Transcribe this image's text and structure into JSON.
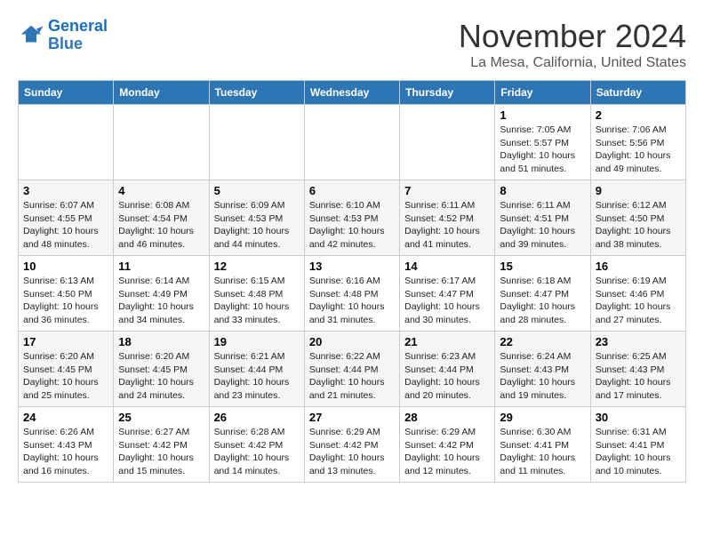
{
  "header": {
    "logo_line1": "General",
    "logo_line2": "Blue",
    "month": "November 2024",
    "location": "La Mesa, California, United States"
  },
  "weekdays": [
    "Sunday",
    "Monday",
    "Tuesday",
    "Wednesday",
    "Thursday",
    "Friday",
    "Saturday"
  ],
  "weeks": [
    [
      {
        "day": "",
        "info": ""
      },
      {
        "day": "",
        "info": ""
      },
      {
        "day": "",
        "info": ""
      },
      {
        "day": "",
        "info": ""
      },
      {
        "day": "",
        "info": ""
      },
      {
        "day": "1",
        "info": "Sunrise: 7:05 AM\nSunset: 5:57 PM\nDaylight: 10 hours\nand 51 minutes."
      },
      {
        "day": "2",
        "info": "Sunrise: 7:06 AM\nSunset: 5:56 PM\nDaylight: 10 hours\nand 49 minutes."
      }
    ],
    [
      {
        "day": "3",
        "info": "Sunrise: 6:07 AM\nSunset: 4:55 PM\nDaylight: 10 hours\nand 48 minutes."
      },
      {
        "day": "4",
        "info": "Sunrise: 6:08 AM\nSunset: 4:54 PM\nDaylight: 10 hours\nand 46 minutes."
      },
      {
        "day": "5",
        "info": "Sunrise: 6:09 AM\nSunset: 4:53 PM\nDaylight: 10 hours\nand 44 minutes."
      },
      {
        "day": "6",
        "info": "Sunrise: 6:10 AM\nSunset: 4:53 PM\nDaylight: 10 hours\nand 42 minutes."
      },
      {
        "day": "7",
        "info": "Sunrise: 6:11 AM\nSunset: 4:52 PM\nDaylight: 10 hours\nand 41 minutes."
      },
      {
        "day": "8",
        "info": "Sunrise: 6:11 AM\nSunset: 4:51 PM\nDaylight: 10 hours\nand 39 minutes."
      },
      {
        "day": "9",
        "info": "Sunrise: 6:12 AM\nSunset: 4:50 PM\nDaylight: 10 hours\nand 38 minutes."
      }
    ],
    [
      {
        "day": "10",
        "info": "Sunrise: 6:13 AM\nSunset: 4:50 PM\nDaylight: 10 hours\nand 36 minutes."
      },
      {
        "day": "11",
        "info": "Sunrise: 6:14 AM\nSunset: 4:49 PM\nDaylight: 10 hours\nand 34 minutes."
      },
      {
        "day": "12",
        "info": "Sunrise: 6:15 AM\nSunset: 4:48 PM\nDaylight: 10 hours\nand 33 minutes."
      },
      {
        "day": "13",
        "info": "Sunrise: 6:16 AM\nSunset: 4:48 PM\nDaylight: 10 hours\nand 31 minutes."
      },
      {
        "day": "14",
        "info": "Sunrise: 6:17 AM\nSunset: 4:47 PM\nDaylight: 10 hours\nand 30 minutes."
      },
      {
        "day": "15",
        "info": "Sunrise: 6:18 AM\nSunset: 4:47 PM\nDaylight: 10 hours\nand 28 minutes."
      },
      {
        "day": "16",
        "info": "Sunrise: 6:19 AM\nSunset: 4:46 PM\nDaylight: 10 hours\nand 27 minutes."
      }
    ],
    [
      {
        "day": "17",
        "info": "Sunrise: 6:20 AM\nSunset: 4:45 PM\nDaylight: 10 hours\nand 25 minutes."
      },
      {
        "day": "18",
        "info": "Sunrise: 6:20 AM\nSunset: 4:45 PM\nDaylight: 10 hours\nand 24 minutes."
      },
      {
        "day": "19",
        "info": "Sunrise: 6:21 AM\nSunset: 4:44 PM\nDaylight: 10 hours\nand 23 minutes."
      },
      {
        "day": "20",
        "info": "Sunrise: 6:22 AM\nSunset: 4:44 PM\nDaylight: 10 hours\nand 21 minutes."
      },
      {
        "day": "21",
        "info": "Sunrise: 6:23 AM\nSunset: 4:44 PM\nDaylight: 10 hours\nand 20 minutes."
      },
      {
        "day": "22",
        "info": "Sunrise: 6:24 AM\nSunset: 4:43 PM\nDaylight: 10 hours\nand 19 minutes."
      },
      {
        "day": "23",
        "info": "Sunrise: 6:25 AM\nSunset: 4:43 PM\nDaylight: 10 hours\nand 17 minutes."
      }
    ],
    [
      {
        "day": "24",
        "info": "Sunrise: 6:26 AM\nSunset: 4:43 PM\nDaylight: 10 hours\nand 16 minutes."
      },
      {
        "day": "25",
        "info": "Sunrise: 6:27 AM\nSunset: 4:42 PM\nDaylight: 10 hours\nand 15 minutes."
      },
      {
        "day": "26",
        "info": "Sunrise: 6:28 AM\nSunset: 4:42 PM\nDaylight: 10 hours\nand 14 minutes."
      },
      {
        "day": "27",
        "info": "Sunrise: 6:29 AM\nSunset: 4:42 PM\nDaylight: 10 hours\nand 13 minutes."
      },
      {
        "day": "28",
        "info": "Sunrise: 6:29 AM\nSunset: 4:42 PM\nDaylight: 10 hours\nand 12 minutes."
      },
      {
        "day": "29",
        "info": "Sunrise: 6:30 AM\nSunset: 4:41 PM\nDaylight: 10 hours\nand 11 minutes."
      },
      {
        "day": "30",
        "info": "Sunrise: 6:31 AM\nSunset: 4:41 PM\nDaylight: 10 hours\nand 10 minutes."
      }
    ]
  ]
}
